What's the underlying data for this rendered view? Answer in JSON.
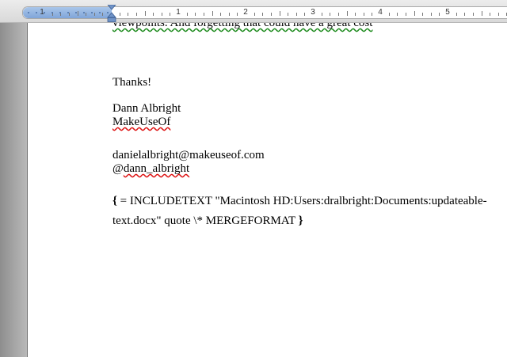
{
  "ruler": {
    "numbers": [
      "1",
      "1",
      "2",
      "3",
      "4",
      "5"
    ]
  },
  "document": {
    "cut_off_line": "viewpoints. And forgetting that could have a great cost",
    "thanks": "Thanks!",
    "signature_name": "Dann Albright",
    "signature_org": "MakeUseOf",
    "email": "danielalbright@makeuseof.com",
    "handle_at": "@",
    "handle_name": "dann_albright",
    "field_open_brace": "{",
    "field_line1": " = INCLUDETEXT \"Macintosh HD:Users:dralbright:Documents:updateable-",
    "field_line2": "text.docx\" quote \\* MERGEFORMAT ",
    "field_close_brace": "}"
  },
  "colors": {
    "spelling_underline": "#dd1111",
    "grammar_underline": "#1c8a1c",
    "ruler_margin": "#7fa5d9"
  }
}
